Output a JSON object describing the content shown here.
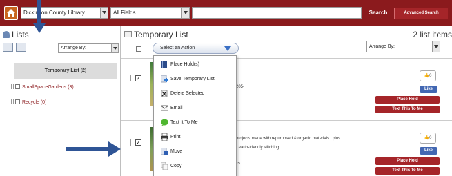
{
  "topbar": {
    "library_select": "Dickinson County Library",
    "field_select": "All Fields",
    "search_value": "",
    "search_label": "Search",
    "advanced_label": "Advanced Search"
  },
  "sidebar": {
    "title": "Lists",
    "arrange_value": "Arrange By:",
    "items": [
      {
        "label": "Temporary List (2)"
      },
      {
        "label": "SmallSpaceGardens (3)"
      },
      {
        "label": "Recycle (0)"
      }
    ]
  },
  "main": {
    "title": "Temporary List",
    "count": "2 list items",
    "action_value": "Select an Action",
    "arrange_value": "Arrange By:"
  },
  "items": [
    {
      "snippet": "205-",
      "likes": "0",
      "like_label": "Like",
      "place_hold": "Place Hold",
      "text_me": "Text This To Me"
    },
    {
      "line1": "projects made with repurposed & organic materials : plus",
      "line2": "r earth-friendly stitching",
      "line3": "ks",
      "likes": "0",
      "like_label": "Like",
      "place_hold": "Place Hold",
      "text_me": "Text This To Me"
    }
  ],
  "menu": {
    "items": [
      {
        "label": "Place Hold(s)",
        "icon": "book-icon"
      },
      {
        "label": "Save Temporary List",
        "icon": "save-list-icon"
      },
      {
        "label": "Delete Selected",
        "icon": "delete-icon"
      },
      {
        "label": "Email",
        "icon": "email-icon"
      },
      {
        "label": "Text It To Me",
        "icon": "text-message-icon"
      },
      {
        "label": "Print",
        "icon": "print-icon"
      },
      {
        "label": "Move",
        "icon": "move-icon"
      },
      {
        "label": "Copy",
        "icon": "copy-icon"
      }
    ]
  },
  "colors": {
    "brand": "#8b1a1d",
    "button_red": "#a52529",
    "annotation_arrow": "#2f5596",
    "facebook": "#4267b2"
  }
}
